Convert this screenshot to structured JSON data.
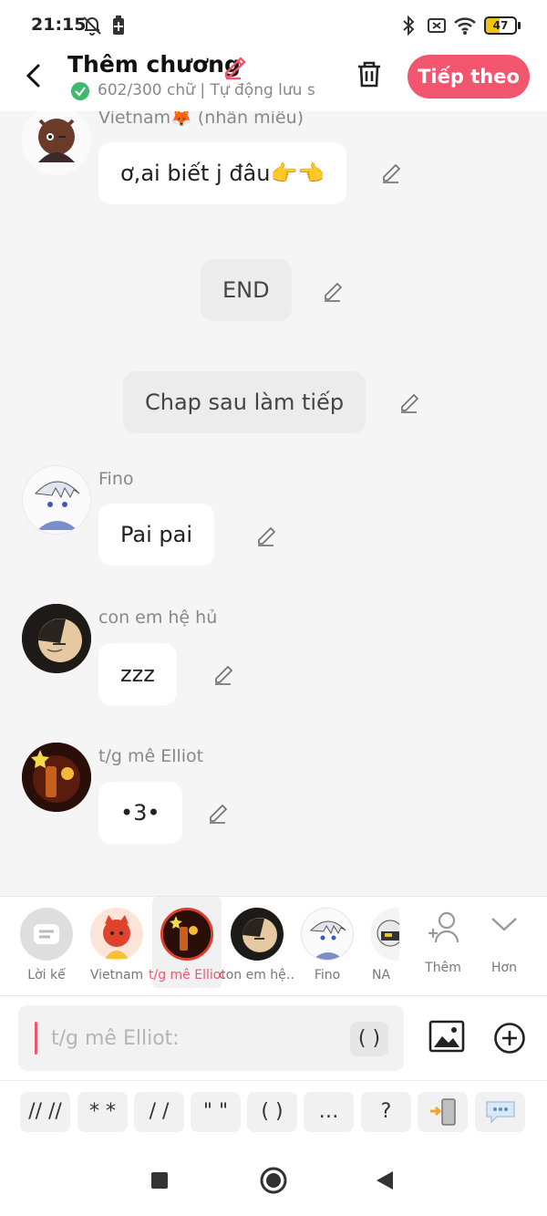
{
  "status_bar": {
    "time": "21:15",
    "battery": "47",
    "battery_level": 0.47
  },
  "header": {
    "title": "Thêm chương",
    "subtitle": "602/300 chữ | Tự động lưu s",
    "next_label": "Tiếp theo"
  },
  "messages": [
    {
      "type": "character",
      "name": "Vietnam🦊 (nhân miêu)",
      "text": "ơ,ai biết j đâu👉👈"
    },
    {
      "type": "narration",
      "text": "END"
    },
    {
      "type": "narration",
      "text": "Chap sau làm tiếp"
    },
    {
      "type": "character",
      "name": "Fino",
      "text": "Pai pai"
    },
    {
      "type": "character",
      "name": "con em hệ hủ",
      "text": "zzz"
    },
    {
      "type": "character",
      "name": "t/g mê Elliot",
      "text": "•3•"
    }
  ],
  "characters": [
    {
      "label": "Lời kể",
      "selected": false
    },
    {
      "label": "Vietnam",
      "selected": false
    },
    {
      "label": "t/g mê Elliot",
      "selected": true
    },
    {
      "label": "con em hệ…",
      "selected": false
    },
    {
      "label": "Fino",
      "selected": false
    },
    {
      "label": "NA",
      "selected": false
    }
  ],
  "char_actions": {
    "more_label": "Thêm",
    "collapse_label": "Hơn"
  },
  "input": {
    "placeholder": "t/g mê Elliot:",
    "paren_label": "( )"
  },
  "symbols": [
    "// //",
    "* *",
    "/ /",
    "\" \"",
    "( )",
    "…"
  ],
  "symbol_question": "?",
  "colors": {
    "accent": "#f2566e",
    "check": "#3dba6e"
  }
}
